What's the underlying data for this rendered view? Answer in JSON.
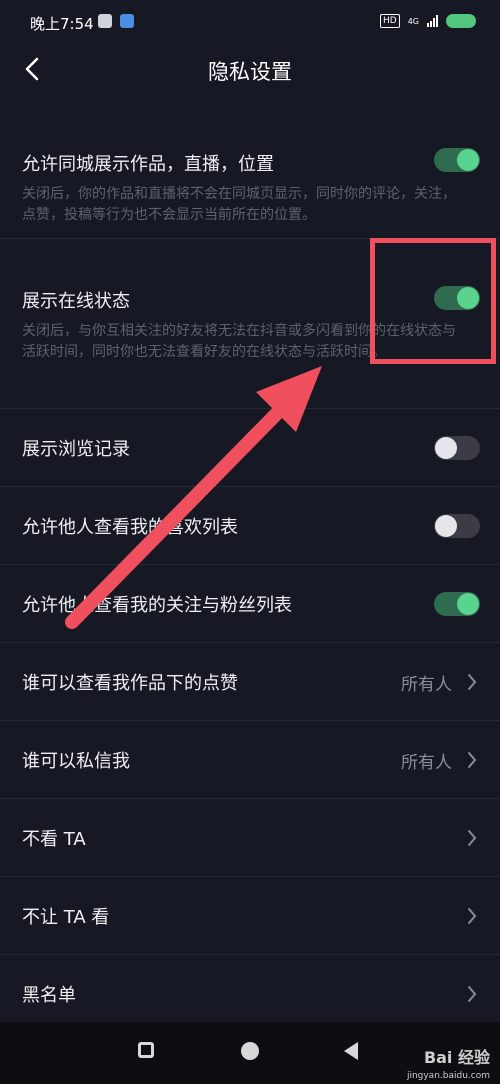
{
  "status_bar": {
    "time": "晚上7:54",
    "hd_label": "HD",
    "network_label": "4G"
  },
  "header": {
    "title": "隐私设置"
  },
  "settings": [
    {
      "title": "允许同城展示作品，直播，位置",
      "description": "关闭后，你的作品和直播将不会在同城页显示，同时你的评论，关注，点赞，投稿等行为也不会显示当前所在的位置。",
      "toggle": "on"
    },
    {
      "title": "展示在线状态",
      "description": "关闭后，与你互相关注的好友将无法在抖音或多闪看到你的在线状态与活跃时间，同时你也无法查看好友的在线状态与活跃时间。",
      "toggle": "on"
    },
    {
      "title": "展示浏览记录",
      "toggle": "off"
    },
    {
      "title": "允许他人查看我的喜欢列表",
      "toggle": "off"
    },
    {
      "title": "允许他人查看我的关注与粉丝列表",
      "toggle": "on"
    },
    {
      "title": "谁可以查看我作品下的点赞",
      "value": "所有人"
    },
    {
      "title": "谁可以私信我",
      "value": "所有人"
    },
    {
      "title": "不看 TA"
    },
    {
      "title": "不让 TA 看"
    },
    {
      "title": "黑名单"
    }
  ],
  "watermark": {
    "brand": "Bai 经验",
    "url": "jingyan.baidu.com"
  },
  "colors": {
    "background": "#161823",
    "toggle_on": "#59d38e",
    "annotation": "#f0505e"
  }
}
